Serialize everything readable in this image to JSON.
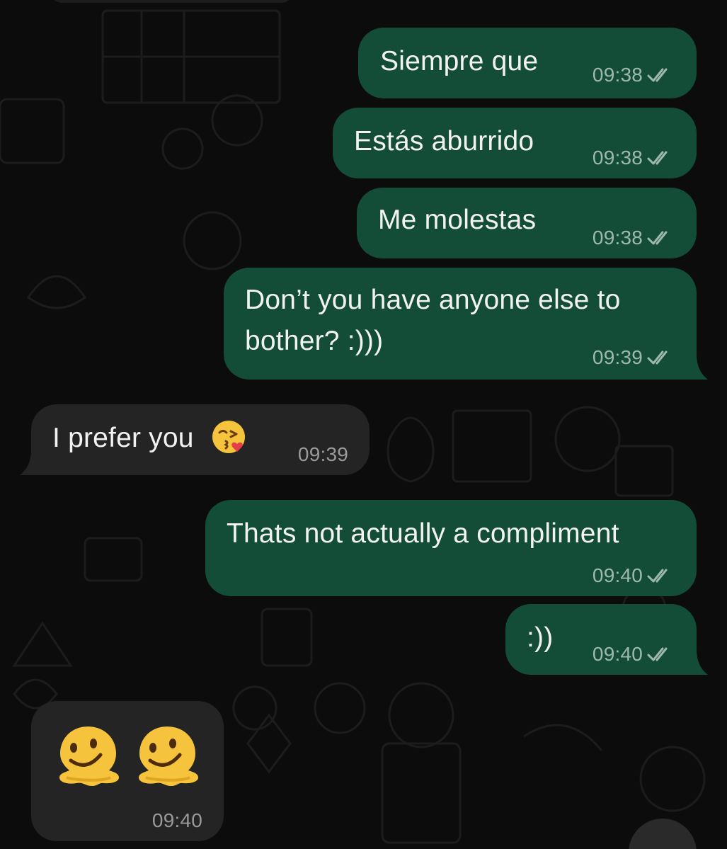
{
  "messages": [
    {
      "id": "m1",
      "direction": "outgoing",
      "text": "Siempre que",
      "time": "09:38",
      "status": "read"
    },
    {
      "id": "m2",
      "direction": "outgoing",
      "text": "Estás aburrido",
      "time": "09:38",
      "status": "read"
    },
    {
      "id": "m3",
      "direction": "outgoing",
      "text": "Me molestas",
      "time": "09:38",
      "status": "read"
    },
    {
      "id": "m4",
      "direction": "outgoing",
      "line1": "Don’t you have anyone else to",
      "line2": "bother? :)))",
      "time": "09:39",
      "status": "read"
    },
    {
      "id": "m5",
      "direction": "incoming",
      "text": "I prefer you",
      "emoji": "face-blowing-a-kiss",
      "time": "09:39"
    },
    {
      "id": "m6",
      "direction": "outgoing",
      "text": "Thats not actually a compliment",
      "time": "09:40",
      "status": "read"
    },
    {
      "id": "m7",
      "direction": "outgoing",
      "text": ":))",
      "time": "09:40",
      "status": "read"
    },
    {
      "id": "m8",
      "direction": "incoming",
      "emoji": [
        "melting-face",
        "melting-face"
      ],
      "time": "09:40"
    }
  ],
  "colors": {
    "outgoing_bubble": "#134d37",
    "incoming_bubble": "#242424",
    "background": "#0c0c0c",
    "read_ticks": "#9fb8ad"
  }
}
